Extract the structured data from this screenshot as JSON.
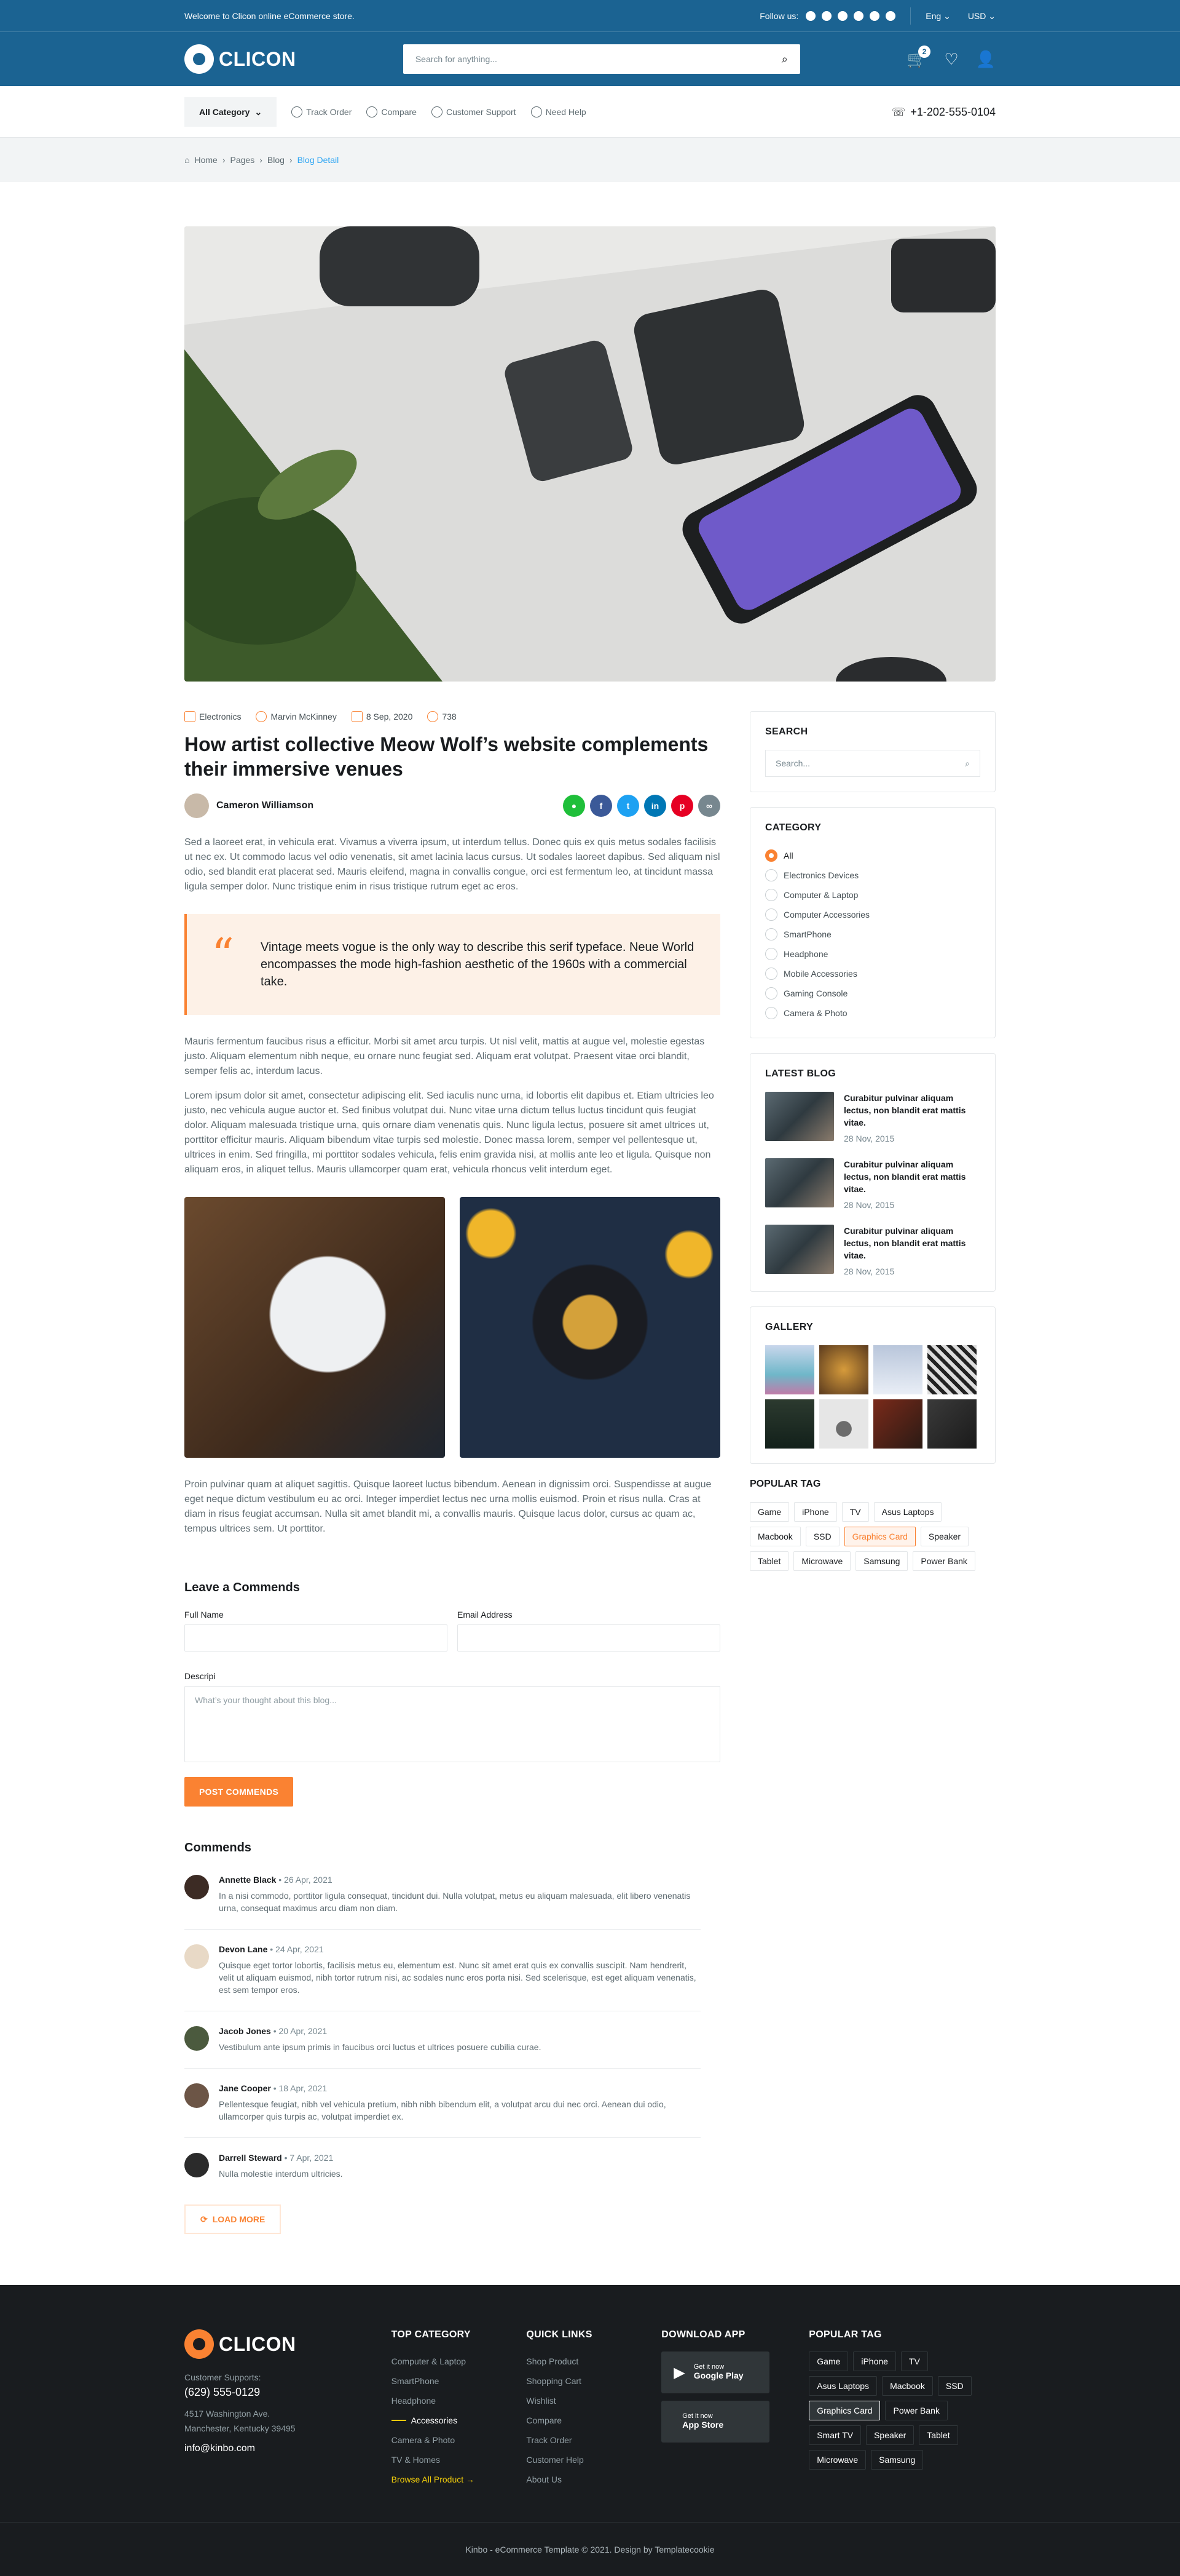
{
  "topbar": {
    "welcome": "Welcome to Clicon online eCommerce store.",
    "follow": "Follow us:",
    "lang": "Eng",
    "currency": "USD"
  },
  "header": {
    "brand": "CLICON",
    "search_placeholder": "Search for anything...",
    "cart_count": "2"
  },
  "nav": {
    "all_category": "All Category",
    "links": [
      "Track Order",
      "Compare",
      "Customer Support",
      "Need Help"
    ],
    "phone": "+1-202-555-0104"
  },
  "breadcrumb": [
    "Home",
    "Pages",
    "Blog",
    "Blog Detail"
  ],
  "post": {
    "category": "Electronics",
    "author_meta": "Marvin McKinney",
    "date": "8 Sep, 2020",
    "comments": "738",
    "title": "How artist collective Meow Wolf’s website complements their immersive venues",
    "author": "Cameron Williamson",
    "share_icons": [
      "whatsapp-icon",
      "facebook-icon",
      "twitter-icon",
      "linkedin-icon",
      "pinterest-icon",
      "link-icon"
    ],
    "p1": "Sed a laoreet erat, in vehicula erat. Vivamus a viverra ipsum, ut interdum tellus. Donec quis ex quis metus sodales facilisis ut nec ex. Ut commodo lacus vel odio venenatis, sit amet lacinia lacus cursus. Ut sodales laoreet dapibus. Sed aliquam nisl odio, sed blandit erat placerat sed. Mauris eleifend, magna in convallis congue, orci est fermentum leo, at tincidunt massa ligula semper dolor. Nunc tristique enim in risus tristique rutrum eget ac eros.",
    "quote": "Vintage meets vogue is the only way to describe this serif typeface. Neue World encompasses the mode high-fashion aesthetic of the 1960s with a commercial take.",
    "p2": "Mauris fermentum faucibus risus a efficitur. Morbi sit amet arcu turpis. Ut nisl velit, mattis at augue vel, molestie egestas justo. Aliquam elementum nibh neque, eu ornare nunc feugiat sed. Aliquam erat volutpat. Praesent vitae orci blandit, semper felis ac, interdum lacus.",
    "p3": "Lorem ipsum dolor sit amet, consectetur adipiscing elit. Sed iaculis nunc urna, id lobortis elit dapibus et. Etiam ultricies leo justo, nec vehicula augue auctor et. Sed finibus volutpat dui. Nunc vitae urna dictum tellus luctus tincidunt quis feugiat dolor. Aliquam malesuada tristique urna, quis ornare diam venenatis quis. Nunc ligula lectus, posuere sit amet ultrices ut, porttitor efficitur mauris. Aliquam bibendum vitae turpis sed molestie. Donec massa lorem, semper vel pellentesque ut, ultrices in enim. Sed fringilla, mi porttitor sodales vehicula, felis enim gravida nisi, at mollis ante leo et ligula. Quisque non aliquam eros, in aliquet tellus. Mauris ullamcorper quam erat, vehicula rhoncus velit interdum eget.",
    "p4": "Proin pulvinar quam at aliquet sagittis. Quisque laoreet luctus bibendum. Aenean in dignissim orci. Suspendisse at augue eget neque dictum vestibulum eu ac orci. Integer imperdiet lectus nec urna mollis euismod. Proin et risus nulla. Cras at diam in risus feugiat accumsan. Nulla sit amet blandit mi, a convallis mauris. Quisque lacus dolor, cursus ac quam ac, tempus ultrices sem. Ut porttitor."
  },
  "form": {
    "title": "Leave a Commends",
    "full_name": "Full Name",
    "email": "Email Address",
    "desc": "Descripi",
    "desc_placeholder": "What’s your thought about this blog...",
    "submit": "POST COMMENDS"
  },
  "comments": {
    "title": "Commends",
    "load_more": "LOAD MORE",
    "items": [
      {
        "name": "Annette Black",
        "date": "• 26 Apr, 2021",
        "text": "In a nisi commodo, porttitor ligula consequat, tincidunt dui. Nulla volutpat, metus eu aliquam malesuada, elit libero venenatis urna, consequat maximus arcu diam non diam."
      },
      {
        "name": "Devon Lane",
        "date": "• 24 Apr, 2021",
        "text": "Quisque eget tortor lobortis, facilisis metus eu, elementum est. Nunc sit amet erat quis ex convallis suscipit. Nam hendrerit, velit ut aliquam euismod, nibh tortor rutrum nisi, ac sodales nunc eros porta nisi. Sed scelerisque, est eget aliquam venenatis, est sem tempor eros."
      },
      {
        "name": "Jacob Jones",
        "date": "• 20 Apr, 2021",
        "text": "Vestibulum ante ipsum primis in faucibus orci luctus et ultrices posuere cubilia curae."
      },
      {
        "name": "Jane Cooper",
        "date": "• 18 Apr, 2021",
        "text": "Pellentesque feugiat, nibh vel vehicula pretium, nibh nibh bibendum elit, a volutpat arcu dui nec orci. Aenean dui odio, ullamcorper quis turpis ac, volutpat imperdiet ex."
      },
      {
        "name": "Darrell Steward",
        "date": "• 7 Apr, 2021",
        "text": "Nulla molestie interdum ultricies."
      }
    ]
  },
  "sidebar": {
    "search_title": "SEARCH",
    "search_placeholder": "Search...",
    "category_title": "CATEGORY",
    "categories": [
      "All",
      "Electronics Devices",
      "Computer & Laptop",
      "Computer Accessories",
      "SmartPhone",
      "Headphone",
      "Mobile Accessories",
      "Gaming Console",
      "Camera & Photo"
    ],
    "latest_title": "LATEST BLOG",
    "latest": [
      {
        "title": "Curabitur pulvinar aliquam lectus, non blandit erat mattis vitae.",
        "date": "28 Nov, 2015"
      },
      {
        "title": "Curabitur pulvinar aliquam lectus, non blandit erat mattis vitae.",
        "date": "28 Nov, 2015"
      },
      {
        "title": "Curabitur pulvinar aliquam lectus, non blandit erat mattis vitae.",
        "date": "28 Nov, 2015"
      }
    ],
    "gallery_title": "GALLERY",
    "tags_title": "POPULAR TAG",
    "tags": [
      "Game",
      "iPhone",
      "TV",
      "Asus Laptops",
      "Macbook",
      "SSD",
      "Graphics Card",
      "Speaker",
      "Tablet",
      "Microwave",
      "Samsung",
      "Power Bank"
    ],
    "active_tag": "Graphics Card"
  },
  "footer": {
    "brand": "CLICON",
    "support_label": "Customer Supports:",
    "support_phone": "(629) 555-0129",
    "address1": "4517 Washington Ave.",
    "address2": "Manchester, Kentucky 39495",
    "email": "info@kinbo.com",
    "top_category_title": "TOP CATEGORY",
    "top_category": [
      "Computer & Laptop",
      "SmartPhone",
      "Headphone",
      "Accessories",
      "Camera & Photo",
      "TV & Homes"
    ],
    "browse_all": "Browse All Product",
    "quick_title": "QUICK LINKS",
    "quick": [
      "Shop Product",
      "Shopping Cart",
      "Wishlist",
      "Compare",
      "Track Order",
      "Customer Help",
      "About Us"
    ],
    "app_title": "DOWNLOAD APP",
    "apps": [
      {
        "small": "Get it now",
        "name": "Google Play"
      },
      {
        "small": "Get it now",
        "name": "App Store"
      }
    ],
    "tags_title": "POPULAR TAG",
    "tags": [
      "Game",
      "iPhone",
      "TV",
      "Asus Laptops",
      "Macbook",
      "SSD",
      "Graphics Card",
      "Power Bank",
      "Smart TV",
      "Speaker",
      "Tablet",
      "Microwave",
      "Samsung"
    ],
    "active_tag": "Graphics Card",
    "copyright": "Kinbo - eCommerce Template © 2021. Design by Templatecookie"
  },
  "colors": {
    "primary": "#fa8232",
    "brand": "#1b6392",
    "dark": "#191c1f"
  }
}
